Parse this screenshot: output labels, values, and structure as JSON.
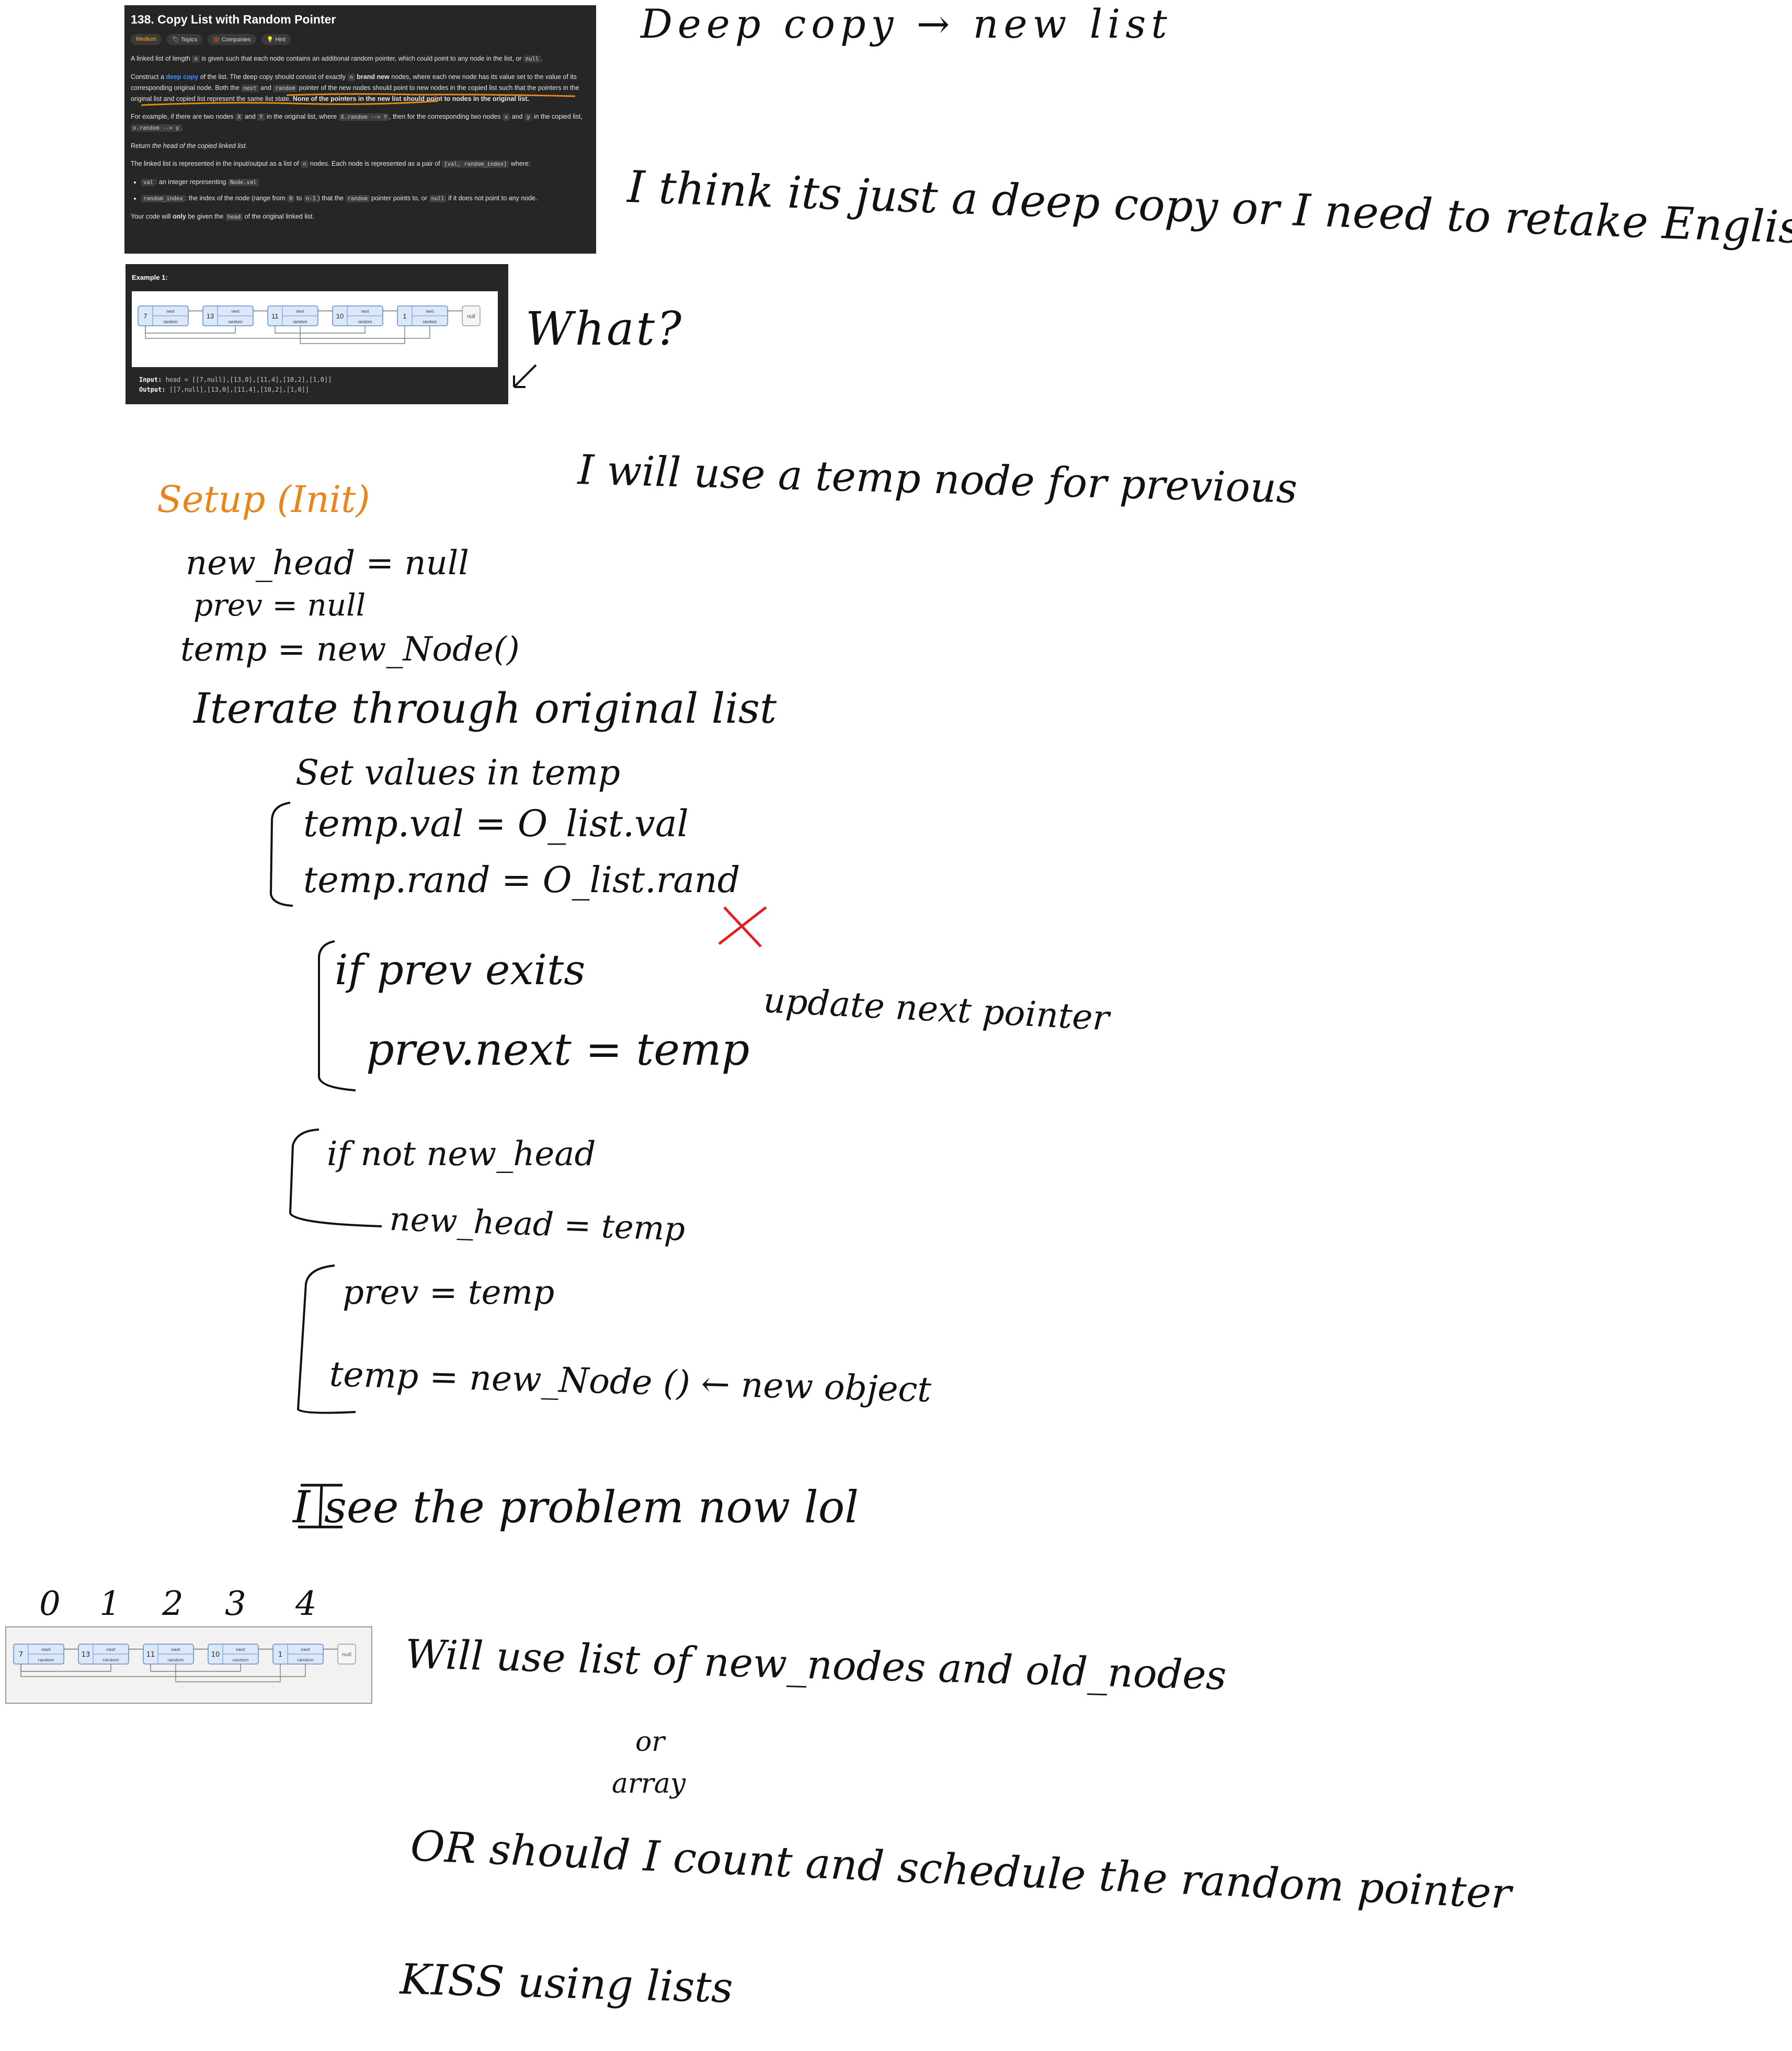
{
  "problem": {
    "title": "138. Copy List with Random Pointer",
    "difficulty": "Medium",
    "tags": [
      "Topics",
      "Companies",
      "Hint"
    ],
    "p1_a": "A linked list of length ",
    "p1_code": "n",
    "p1_b": " is given such that each node contains an additional random pointer, which could point to any node in the list, or ",
    "p1_code2": "null",
    "p1_c": ".",
    "p2_a": "Construct a ",
    "p2_link": "deep copy",
    "p2_b": " of the list. The deep copy should consist of exactly ",
    "p2_code": "n",
    "p2_bold": "brand new",
    "p2_c": " nodes, where each new node has its value set to the value of its corresponding original node. Both the ",
    "p2_code2": "next",
    "p2_and": " and ",
    "p2_code3": "random",
    "p2_d": " pointer of the new nodes should point to new nodes in the copied list such that the pointers in the original list and copied list represent the same list state. ",
    "p2_bold2": "None of the pointers in the new list should point to nodes in the original list.",
    "p3_a": "For example, if there are two nodes ",
    "p3_x": "X",
    "p3_and": " and ",
    "p3_y": "Y",
    "p3_b": " in the original list, where ",
    "p3_code": "X.random --> Y",
    "p3_c": ", then for the corresponding two nodes ",
    "p3_x2": "x",
    "p3_and2": " and ",
    "p3_y2": "y",
    "p3_d": " in the copied list, ",
    "p3_code2": "x.random --> y",
    "p3_e": ".",
    "p4_a": "Return ",
    "p4_i": "the head of the copied linked list",
    "p4_b": ".",
    "p5_a": "The linked list is represented in the input/output as a list of ",
    "p5_code": "n",
    "p5_b": " nodes. Each node is represented as a pair of ",
    "p5_code2": "[val, random_index]",
    "p5_c": " where:",
    "li1_code": "val",
    "li1_a": ": an integer representing ",
    "li1_code2": "Node.val",
    "li2_code": "random_index",
    "li2_a": ": the index of the node (range from ",
    "li2_code2": "0",
    "li2_b": " to ",
    "li2_code3": "n-1",
    "li2_c": ") that the ",
    "li2_code4": "random",
    "li2_d": " pointer points to, or ",
    "li2_code5": "null",
    "li2_e": " if it does not point to any node.",
    "p6_a": "Your code will ",
    "p6_b": "only",
    "p6_c": " be given the ",
    "p6_code": "head",
    "p6_d": " of the original linked list."
  },
  "example": {
    "title": "Example 1:",
    "input_label": "Input:",
    "input_value": "head = [[7,null],[13,0],[11,4],[10,2],[1,0]]",
    "output_label": "Output:",
    "output_value": "[[7,null],[13,0],[11,4],[10,2],[1,0]]",
    "nodes": [
      "7",
      "13",
      "11",
      "10",
      "1"
    ],
    "next_label": "next",
    "random_label": "random",
    "null_label": "null"
  },
  "diagram2": {
    "indices": [
      "0",
      "1",
      "2",
      "3",
      "4"
    ]
  },
  "notes": {
    "deep_copy": "Deep copy → new list",
    "think": "I think its just a deep copy or I need to retake English",
    "what": "What?",
    "temp_node": "I will use a temp node for previous",
    "setup": "Setup (Init)",
    "new_head": "new_head = null",
    "prev": "prev = null",
    "temp_new": "temp = new_Node()",
    "iterate": "Iterate through original list",
    "set_values": "Set values in temp",
    "temp_val": "temp.val = O_list.val",
    "temp_rand": "temp.rand = O_list.rand",
    "if_prev": "if prev exits",
    "update_next": "update next pointer",
    "prev_next": "prev.next = temp",
    "if_not_head": "if not new_head",
    "new_head_temp": "new_head = temp",
    "prev_temp": "prev = temp",
    "temp_new2": "temp = new_Node () ← new object",
    "see_problem": "I see the problem now lol",
    "will_use": "Will use list of new_nodes and old_nodes",
    "or": "or",
    "array": "array",
    "or_should": "OR should I count and schedule the random pointer",
    "kiss": "KISS using lists"
  },
  "colors": {
    "orange": "#e8851c",
    "red": "#e02020",
    "node_fill": "#dce8f7",
    "node_border": "#5b8ed6"
  }
}
